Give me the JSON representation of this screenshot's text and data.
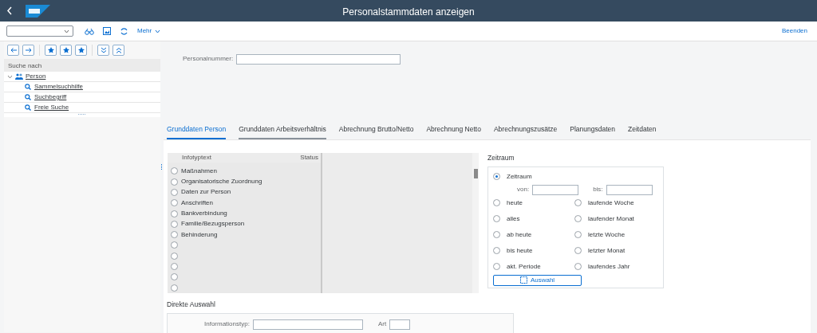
{
  "window": {
    "title": "Personalstammdaten anzeigen"
  },
  "toolbar": {
    "more": "Mehr",
    "exit": "Beenden"
  },
  "sidebar": {
    "heading": "Suche nach",
    "tree": [
      {
        "label": "Person",
        "expanded": true,
        "children": [
          {
            "label": "Sammelsuchhilfe"
          },
          {
            "label": "Suchbegriff"
          },
          {
            "label": "Freie Suche"
          }
        ]
      }
    ]
  },
  "personnel_number": {
    "label": "Personalnummer:"
  },
  "tabs": [
    {
      "label": "Grunddaten Person",
      "selected": true
    },
    {
      "label": "Grunddaten Arbeitsverhältnis",
      "selected": false
    },
    {
      "label": "Abrechnung Brutto/Netto",
      "selected": false
    },
    {
      "label": "Abrechnung Netto",
      "selected": false
    },
    {
      "label": "Abrechnungszusätze",
      "selected": false
    },
    {
      "label": "Planungsdaten",
      "selected": false
    },
    {
      "label": "Zeitdaten",
      "selected": false
    }
  ],
  "infotypes": {
    "columns": [
      "Infotyptext",
      "Status"
    ],
    "rows": [
      {
        "label": "Maßnahmen",
        "selected": false
      },
      {
        "label": "Organisatorische Zuordnung",
        "selected": false
      },
      {
        "label": "Daten zur Person",
        "selected": false
      },
      {
        "label": "Anschriften",
        "selected": false
      },
      {
        "label": "Bankverbindung",
        "selected": false
      },
      {
        "label": "Familie/Bezugsperson",
        "selected": false
      },
      {
        "label": "Behinderung",
        "selected": false
      },
      {
        "selected": false
      },
      {
        "selected": false
      },
      {
        "selected": false
      },
      {
        "selected": false
      },
      {
        "selected": false
      }
    ]
  },
  "period": {
    "title": "Zeitraum",
    "main": {
      "label": "Zeitraum",
      "selected": true
    },
    "from_label": "von:",
    "to_label": "bis:",
    "options": [
      {
        "label": "heute",
        "selected": false
      },
      {
        "label": "laufende Woche",
        "selected": false
      },
      {
        "label": "alles",
        "selected": false
      },
      {
        "label": "laufender Monat",
        "selected": false
      },
      {
        "label": "ab heute",
        "selected": false
      },
      {
        "label": "letzte Woche",
        "selected": false
      },
      {
        "label": "bis heute",
        "selected": false
      },
      {
        "label": "letzter Monat",
        "selected": false
      },
      {
        "label": "akt. Periode",
        "selected": false
      },
      {
        "label": "laufendes Jahr",
        "selected": false
      }
    ],
    "button": "Auswahl"
  },
  "direct": {
    "title": "Direkte Auswahl",
    "infotype_label": "Informationstyp:",
    "subtype_label": "Art"
  }
}
